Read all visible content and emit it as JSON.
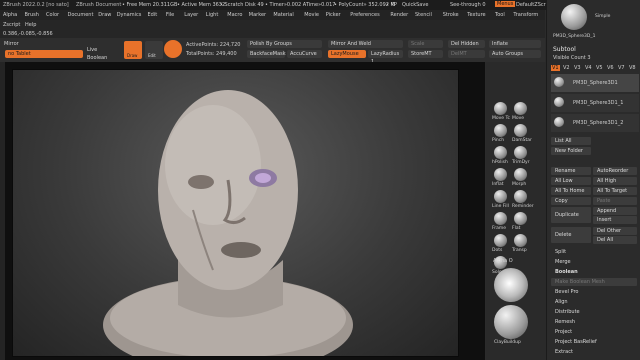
{
  "titlebar": {
    "app": "ZBrush 2022.0.2 [no sato]",
    "doc": "ZBrush Document",
    "freemem": "• Free Mem 20.311GB",
    "activemem": "• Active Mem 3632",
    "scratch": "• Scratch Disk 49",
    "timer": "• Timer»0.002 ATime»0.017",
    "polycount": "• PolyCount» 352.092 KP",
    "meshcount": "• M",
    "quicksave": "QuickSave",
    "seethrough": "See-through 0",
    "menus_label": "Menus",
    "script": "DefaultZScript"
  },
  "menubar": [
    "Alpha",
    "Brush",
    "Color",
    "Document",
    "Draw",
    "Dynamics",
    "Edit",
    "File",
    "Layer",
    "Light",
    "Macro",
    "Marker",
    "Material",
    "Movie",
    "Picker",
    "Preferences",
    "Render",
    "Stencil",
    "Stroke",
    "Texture",
    "Tool",
    "Transform",
    "Zplugin"
  ],
  "menubar2": [
    "Zscript",
    "Help"
  ],
  "infobar": "0.386,-0.085,-0.856",
  "toolbar": {
    "mirror": "Mirror",
    "mirror_value": "no Tablet",
    "live_boolean": "Live Boolean",
    "draw": "Draw",
    "edit": "Edit",
    "active_points": "ActivePoints: 224,720",
    "total_points": "TotalPoints: 249,400",
    "polish_by_groups": "Polish By Groups",
    "backface_mask": "BackfaceMask",
    "accucurve": "AccuCurve",
    "mirror_weld": "Mirror And Weld",
    "lazymouse": "LazyMouse",
    "lazyradius": "LazyRadius 1",
    "scale": "Scale",
    "storemt": "StoreMT",
    "del_hidden": "Del Hidden",
    "delmt": "DelMT",
    "inflate": "Inflate",
    "auto_groups": "Auto Groups"
  },
  "brushes": [
    "Move Tc",
    "Move",
    "Pinch",
    "DamStar",
    "hPolish",
    "TrimDyr",
    "Inflat",
    "Morph",
    "Line Fill",
    "Reminder",
    "Frame",
    "Flat",
    "Dots",
    "Transp",
    "Solo"
  ],
  "alpha": {
    "label": "Alpha O",
    "material": "ClayBuildup"
  },
  "subtool": {
    "title": "Subtool",
    "visible_count": "Visible Count 3",
    "tabs": [
      "V1",
      "V2",
      "V3",
      "V4",
      "V5",
      "V6",
      "V7",
      "V8"
    ],
    "items": [
      "PM3D_Sphere3D1",
      "PM3D_Sphere3D1_1",
      "PM3D_Sphere3D1_2"
    ],
    "tool_name": "PM3D_Sphere3D_1",
    "simple_label": "Simple"
  },
  "palette_buttons": {
    "list_all": "List All",
    "new_folder": "New Folder",
    "rename": "Rename",
    "autoreorder": "AutoReorder",
    "all_low": "All Low",
    "all_high": "All High",
    "to_home": "All To Home",
    "to_target": "All To Target",
    "copy": "Copy",
    "paste": "Paste",
    "duplicate": "Duplicate",
    "append": "Append",
    "insert": "Insert",
    "delete": "Delete",
    "del_other": "Del Other",
    "del_all": "Del All",
    "split": "Split",
    "merge": "Merge",
    "boolean": "Boolean",
    "make_boolean": "Make Boolean Mesh",
    "bevel_pro": "Bevel Pro",
    "align": "Align",
    "distribute": "Distribute",
    "remesh": "Remesh",
    "project": "Project",
    "project_basrelief": "Project BasRelief",
    "extract": "Extract"
  },
  "colors": {
    "accent": "#e8722a",
    "bg": "#2b2b2b",
    "viewport": "#3a3a3a"
  }
}
